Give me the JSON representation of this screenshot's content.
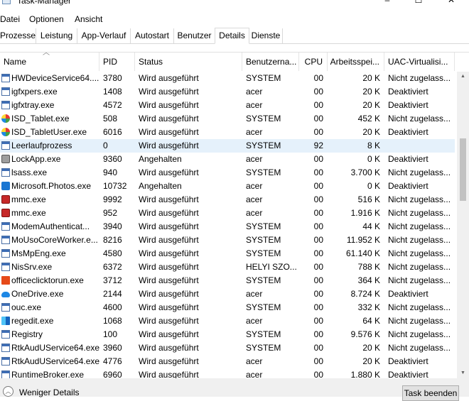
{
  "window": {
    "title": "Task-Manager",
    "minimize_glyph": "–",
    "maximize_glyph": "☐",
    "close_glyph": "✕"
  },
  "menu": [
    "Datei",
    "Optionen",
    "Ansicht"
  ],
  "tabs": [
    "Prozesse",
    "Leistung",
    "App-Verlauf",
    "Autostart",
    "Benutzer",
    "Details",
    "Dienste"
  ],
  "active_tab": "Details",
  "columns": [
    "Name",
    "PID",
    "Status",
    "Benutzerna...",
    "CPU",
    "Arbeitsspei...",
    "UAC-Virtualisi..."
  ],
  "sort_column": "Name",
  "rows": [
    {
      "icon": "generic-app-icon",
      "name": "HWDeviceService64....",
      "pid": "3780",
      "status": "Wird ausgeführt",
      "user": "SYSTEM",
      "cpu": "00",
      "mem": "20 K",
      "uac": "Nicht zugelass..."
    },
    {
      "icon": "generic-app-icon",
      "name": "igfxpers.exe",
      "pid": "1408",
      "status": "Wird ausgeführt",
      "user": "acer",
      "cpu": "00",
      "mem": "20 K",
      "uac": "Deaktiviert"
    },
    {
      "icon": "generic-app-icon",
      "name": "igfxtray.exe",
      "pid": "4572",
      "status": "Wird ausgeführt",
      "user": "acer",
      "cpu": "00",
      "mem": "20 K",
      "uac": "Deaktiviert"
    },
    {
      "icon": "tablet-app-icon",
      "name": "ISD_Tablet.exe",
      "pid": "508",
      "status": "Wird ausgeführt",
      "user": "SYSTEM",
      "cpu": "00",
      "mem": "452 K",
      "uac": "Nicht zugelass..."
    },
    {
      "icon": "tablet-app-icon",
      "name": "ISD_TabletUser.exe",
      "pid": "6016",
      "status": "Wird ausgeführt",
      "user": "acer",
      "cpu": "00",
      "mem": "20 K",
      "uac": "Deaktiviert"
    },
    {
      "icon": "generic-app-icon",
      "name": "Leerlaufprozess",
      "pid": "0",
      "status": "Wird ausgeführt",
      "user": "SYSTEM",
      "cpu": "92",
      "mem": "8 K",
      "uac": "",
      "selected": true
    },
    {
      "icon": "lock-icon",
      "name": "LockApp.exe",
      "pid": "9360",
      "status": "Angehalten",
      "user": "acer",
      "cpu": "00",
      "mem": "0 K",
      "uac": "Deaktiviert"
    },
    {
      "icon": "generic-app-icon",
      "name": "lsass.exe",
      "pid": "940",
      "status": "Wird ausgeführt",
      "user": "SYSTEM",
      "cpu": "00",
      "mem": "3.700 K",
      "uac": "Nicht zugelass..."
    },
    {
      "icon": "photos-icon",
      "name": "Microsoft.Photos.exe",
      "pid": "10732",
      "status": "Angehalten",
      "user": "acer",
      "cpu": "00",
      "mem": "0 K",
      "uac": "Deaktiviert"
    },
    {
      "icon": "mmc-icon",
      "name": "mmc.exe",
      "pid": "9992",
      "status": "Wird ausgeführt",
      "user": "acer",
      "cpu": "00",
      "mem": "516 K",
      "uac": "Nicht zugelass..."
    },
    {
      "icon": "mmc-icon",
      "name": "mmc.exe",
      "pid": "952",
      "status": "Wird ausgeführt",
      "user": "acer",
      "cpu": "00",
      "mem": "1.916 K",
      "uac": "Nicht zugelass..."
    },
    {
      "icon": "generic-app-icon",
      "name": "ModemAuthenticat...",
      "pid": "3940",
      "status": "Wird ausgeführt",
      "user": "SYSTEM",
      "cpu": "00",
      "mem": "44 K",
      "uac": "Nicht zugelass..."
    },
    {
      "icon": "generic-app-icon",
      "name": "MoUsoCoreWorker.e...",
      "pid": "8216",
      "status": "Wird ausgeführt",
      "user": "SYSTEM",
      "cpu": "00",
      "mem": "11.952 K",
      "uac": "Nicht zugelass..."
    },
    {
      "icon": "generic-app-icon",
      "name": "MsMpEng.exe",
      "pid": "4580",
      "status": "Wird ausgeführt",
      "user": "SYSTEM",
      "cpu": "00",
      "mem": "61.140 K",
      "uac": "Nicht zugelass..."
    },
    {
      "icon": "generic-app-icon",
      "name": "NisSrv.exe",
      "pid": "6372",
      "status": "Wird ausgeführt",
      "user": "HELYI SZO...",
      "cpu": "00",
      "mem": "788 K",
      "uac": "Nicht zugelass..."
    },
    {
      "icon": "office-icon",
      "name": "officeclicktorun.exe",
      "pid": "3712",
      "status": "Wird ausgeführt",
      "user": "SYSTEM",
      "cpu": "00",
      "mem": "364 K",
      "uac": "Nicht zugelass..."
    },
    {
      "icon": "onedrive-cloud-icon",
      "name": "OneDrive.exe",
      "pid": "2144",
      "status": "Wird ausgeführt",
      "user": "acer",
      "cpu": "00",
      "mem": "8.724 K",
      "uac": "Deaktiviert"
    },
    {
      "icon": "generic-app-icon",
      "name": "ouc.exe",
      "pid": "4600",
      "status": "Wird ausgeführt",
      "user": "SYSTEM",
      "cpu": "00",
      "mem": "332 K",
      "uac": "Nicht zugelass..."
    },
    {
      "icon": "regedit-icon",
      "name": "regedit.exe",
      "pid": "1068",
      "status": "Wird ausgeführt",
      "user": "acer",
      "cpu": "00",
      "mem": "64 K",
      "uac": "Nicht zugelass..."
    },
    {
      "icon": "generic-app-icon",
      "name": "Registry",
      "pid": "100",
      "status": "Wird ausgeführt",
      "user": "SYSTEM",
      "cpu": "00",
      "mem": "9.576 K",
      "uac": "Nicht zugelass..."
    },
    {
      "icon": "generic-app-icon",
      "name": "RtkAudUService64.exe",
      "pid": "3960",
      "status": "Wird ausgeführt",
      "user": "SYSTEM",
      "cpu": "00",
      "mem": "20 K",
      "uac": "Nicht zugelass..."
    },
    {
      "icon": "generic-app-icon",
      "name": "RtkAudUService64.exe",
      "pid": "4776",
      "status": "Wird ausgeführt",
      "user": "acer",
      "cpu": "00",
      "mem": "20 K",
      "uac": "Deaktiviert"
    },
    {
      "icon": "generic-app-icon",
      "name": "RuntimeBroker.exe",
      "pid": "6960",
      "status": "Wird ausgeführt",
      "user": "acer",
      "cpu": "00",
      "mem": "1.880 K",
      "uac": "Deaktiviert"
    }
  ],
  "footer": {
    "fewer_details": "Weniger Details",
    "end_task": "Task beenden"
  },
  "colors": {
    "selected_row": "#e5f1fb",
    "footer_bg": "#f0f0f0"
  }
}
